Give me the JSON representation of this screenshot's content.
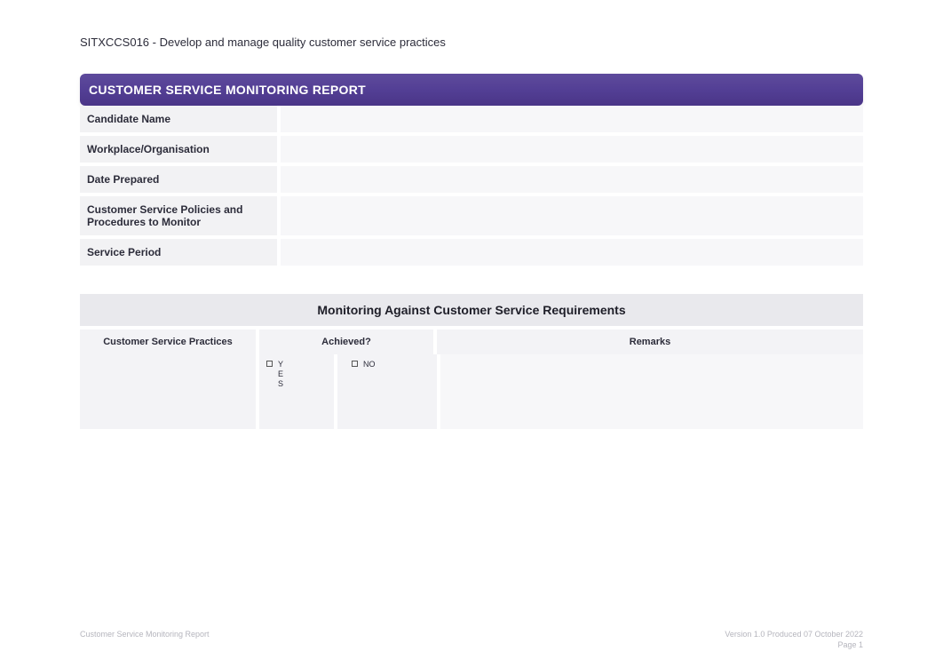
{
  "doc_title": "SITXCCS016 - Develop and manage quality customer service practices",
  "banner": "CUSTOMER SERVICE MONITORING REPORT",
  "info_labels": {
    "candidate": "Candidate Name",
    "workplace": "Workplace/Organisation",
    "date_prepared": "Date Prepared",
    "policies": "Customer Service Policies and Procedures to Monitor",
    "service_period": "Service Period"
  },
  "info_values": {
    "candidate": "",
    "workplace": "",
    "date_prepared": "",
    "policies": "",
    "service_period": ""
  },
  "section_header": "Monitoring Against Customer Service Requirements",
  "table_headers": {
    "practices": "Customer Service Practices",
    "achieved": "Achieved?",
    "remarks": "Remarks"
  },
  "checkbox_labels": {
    "yes": "YES",
    "no": "NO"
  },
  "footer": {
    "left": "Customer Service Monitoring Report",
    "right_line1": "Version 1.0 Produced 07 October 2022",
    "right_line2": "Page 1"
  }
}
